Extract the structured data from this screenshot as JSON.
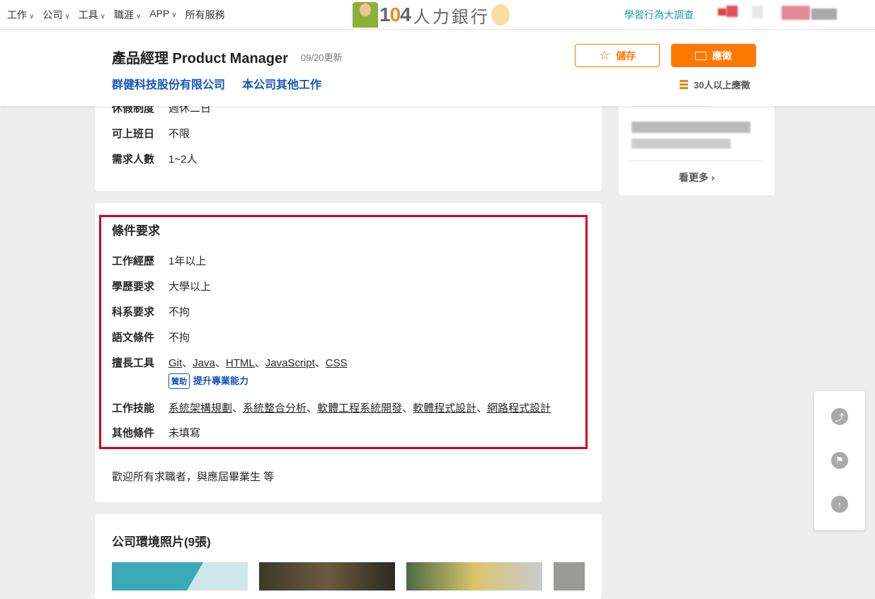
{
  "topnav": {
    "items": [
      "工作",
      "公司",
      "工具",
      "職涯",
      "APP",
      "所有服務"
    ],
    "logo": "104人力銀行",
    "survey": "學習行為大調查"
  },
  "job": {
    "title": "產品經理 Product Manager",
    "updated": "09/20更新",
    "company": "群健科技股份有限公司",
    "other_jobs": "本公司其他工作",
    "save": "儲存",
    "apply": "應徵",
    "applicants": "30人以上應徵"
  },
  "conditions_top": [
    {
      "k": "休假制度",
      "v": "週休二日"
    },
    {
      "k": "可上班日",
      "v": "不限"
    },
    {
      "k": "需求人數",
      "v": "1~2人"
    }
  ],
  "requirements": {
    "title": "條件要求",
    "experience": {
      "k": "工作經歷",
      "v": "1年以上"
    },
    "education": {
      "k": "學歷要求",
      "v": "大學以上"
    },
    "major": {
      "k": "科系要求",
      "v": "不拘"
    },
    "language": {
      "k": "語文條件",
      "v": "不拘"
    },
    "tools": {
      "k": "擅長工具",
      "items": [
        "Git",
        "Java",
        "HTML",
        "JavaScript",
        "CSS"
      ],
      "sponsor_badge": "贊助",
      "sponsor_link": "提升專業能力"
    },
    "skills": {
      "k": "工作技能",
      "items": [
        "系統架構規劃",
        "系統整合分析",
        "軟體工程系統開發",
        "軟體程式設計",
        "網路程式設計"
      ]
    },
    "other": {
      "k": "其他條件",
      "v": "未填寫"
    },
    "welcome": "歡迎所有求職者，與應屆畢業生 等"
  },
  "photos": {
    "title": "公司環境照片(9張)"
  },
  "side": {
    "more": "看更多"
  },
  "sep": "、",
  "colors": {
    "accent": "#ff7800",
    "link": "#1654b9",
    "highlight": "#d0021b"
  }
}
